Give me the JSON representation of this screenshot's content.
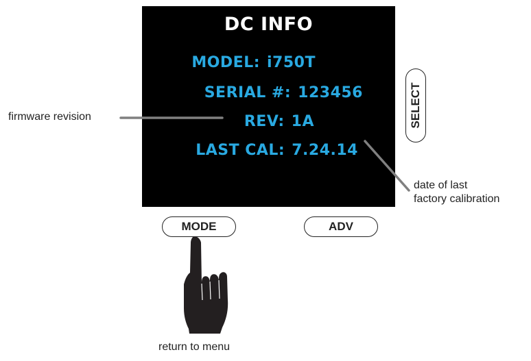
{
  "screen": {
    "title": "DC INFO",
    "lines": [
      {
        "label": "MODEL:",
        "value": "i750T"
      },
      {
        "label": "SERIAL #:",
        "value": "123456"
      },
      {
        "label": "REV:",
        "value": "1A"
      },
      {
        "label": "LAST CAL:",
        "value": "7.24.14"
      }
    ]
  },
  "buttons": {
    "mode": "MODE",
    "adv": "ADV",
    "select": "SELECT"
  },
  "callouts": {
    "firmware": "firmware revision",
    "calibration_line1": "date of last",
    "calibration_line2": "factory calibration",
    "return": "return to menu"
  },
  "colors": {
    "screen_background": "#000000",
    "screen_title": "#ffffff",
    "screen_text": "#29a9e1",
    "callout_line": "#808080"
  },
  "icons": {
    "hand": "pointing-hand-icon"
  }
}
